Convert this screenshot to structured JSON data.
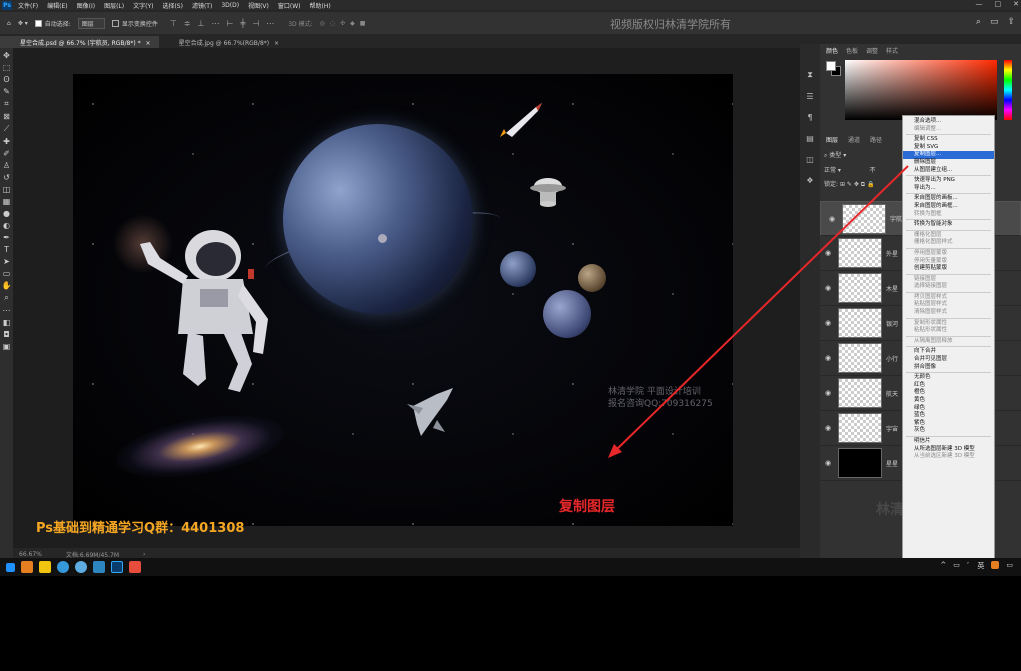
{
  "menubar": {
    "app_icon": "Ps",
    "items": [
      "文件(F)",
      "编辑(E)",
      "图像(I)",
      "图层(L)",
      "文字(Y)",
      "选择(S)",
      "滤镜(T)",
      "3D(D)",
      "视图(V)",
      "窗口(W)",
      "帮助(H)"
    ],
    "window_controls": [
      "—",
      "□",
      "✕"
    ]
  },
  "options": {
    "auto_select_label": "自动选择:",
    "auto_select_value": "图层",
    "transform_label": "显示变换控件",
    "mode_3d_label": "3D 模式:",
    "watermark": "视频版权归林清学院所有"
  },
  "doc_tabs": [
    {
      "label": "星空合成.psd @ 66.7% (宇航员, RGB/8*) *",
      "close": "×"
    },
    {
      "label": "星空合成.jpg @ 66.7%(RGB/8*)",
      "close": "×"
    }
  ],
  "canvas": {
    "wm_line1": "林清学院  平面设计培训",
    "wm_line2": "报名咨询QQ:709316275",
    "copy_label": "复制图层",
    "qq_group": "Ps基础到精通学习Q群：4401308"
  },
  "status": {
    "zoom": "66.67%",
    "doc": "文档:6.69M/45.7M",
    "arrow": "›"
  },
  "color_panel": {
    "tabs": [
      "颜色",
      "色板",
      "调整",
      "样式"
    ]
  },
  "layers_panel": {
    "tabs": [
      "图层",
      "通道",
      "路径"
    ],
    "filter_label": "类型",
    "blend_mode": "正常",
    "opacity_label": "不",
    "lock_label": "锁定:",
    "layers": [
      {
        "name": "宇航",
        "selected": true,
        "dark": false
      },
      {
        "name": "外星",
        "selected": false,
        "dark": false
      },
      {
        "name": "木星",
        "selected": false,
        "dark": false
      },
      {
        "name": "银河",
        "selected": false,
        "dark": false
      },
      {
        "name": "小行",
        "selected": false,
        "dark": false
      },
      {
        "name": "航天",
        "selected": false,
        "dark": false
      },
      {
        "name": "宇宙",
        "selected": false,
        "dark": false
      },
      {
        "name": "星星",
        "selected": false,
        "dark": true
      }
    ],
    "panel_watermark": "林清学院"
  },
  "context_menu": [
    {
      "label": "混合选项...",
      "state": "normal"
    },
    {
      "label": "编辑调整...",
      "state": "disabled"
    },
    {
      "sep": true
    },
    {
      "label": "复制 CSS",
      "state": "normal"
    },
    {
      "label": "复制 SVG",
      "state": "normal"
    },
    {
      "label": "复制图层...",
      "state": "highlight"
    },
    {
      "label": "删除图层",
      "state": "normal"
    },
    {
      "label": "从图层建立组...",
      "state": "normal"
    },
    {
      "sep": true
    },
    {
      "label": "快速导出为 PNG",
      "state": "normal"
    },
    {
      "label": "导出为...",
      "state": "normal"
    },
    {
      "sep": true
    },
    {
      "label": "来自图层的画板...",
      "state": "normal"
    },
    {
      "label": "来自图层的画框...",
      "state": "normal"
    },
    {
      "label": "转换为图框",
      "state": "disabled"
    },
    {
      "sep": true
    },
    {
      "label": "转换为智能对象",
      "state": "normal"
    },
    {
      "sep": true
    },
    {
      "label": "栅格化图层",
      "state": "disabled"
    },
    {
      "label": "栅格化图层样式",
      "state": "disabled"
    },
    {
      "sep": true
    },
    {
      "label": "停用图层蒙版",
      "state": "disabled"
    },
    {
      "label": "停用矢量蒙版",
      "state": "disabled"
    },
    {
      "label": "创建剪贴蒙版",
      "state": "normal"
    },
    {
      "sep": true
    },
    {
      "label": "链接图层",
      "state": "disabled"
    },
    {
      "label": "选择链接图层",
      "state": "disabled"
    },
    {
      "sep": true
    },
    {
      "label": "拷贝图层样式",
      "state": "disabled"
    },
    {
      "label": "粘贴图层样式",
      "state": "disabled"
    },
    {
      "label": "清除图层样式",
      "state": "disabled"
    },
    {
      "sep": true
    },
    {
      "label": "复制形状属性",
      "state": "disabled"
    },
    {
      "label": "粘贴形状属性",
      "state": "disabled"
    },
    {
      "sep": true
    },
    {
      "label": "从隔离图层释放",
      "state": "disabled"
    },
    {
      "sep": true
    },
    {
      "label": "向下合并",
      "state": "normal"
    },
    {
      "label": "合并可见图层",
      "state": "normal"
    },
    {
      "label": "拼合图像",
      "state": "normal"
    },
    {
      "sep": true
    },
    {
      "label": "无颜色",
      "state": "normal"
    },
    {
      "label": "红色",
      "state": "normal"
    },
    {
      "label": "橙色",
      "state": "normal"
    },
    {
      "label": "黄色",
      "state": "normal"
    },
    {
      "label": "绿色",
      "state": "normal"
    },
    {
      "label": "蓝色",
      "state": "normal"
    },
    {
      "label": "紫色",
      "state": "normal"
    },
    {
      "label": "灰色",
      "state": "normal"
    },
    {
      "sep": true
    },
    {
      "label": "明信片",
      "state": "normal"
    },
    {
      "label": "从所选图层新建 3D 模型",
      "state": "normal"
    },
    {
      "label": "从当前选区新建 3D 模型",
      "state": "disabled"
    }
  ],
  "taskbar": {
    "tray": [
      "^",
      "▭",
      "ﾞ",
      "英"
    ]
  },
  "colors": {
    "accent_red": "#e8272a",
    "qq_orange": "#f5a623",
    "menu_highlight": "#2a6bd6"
  }
}
